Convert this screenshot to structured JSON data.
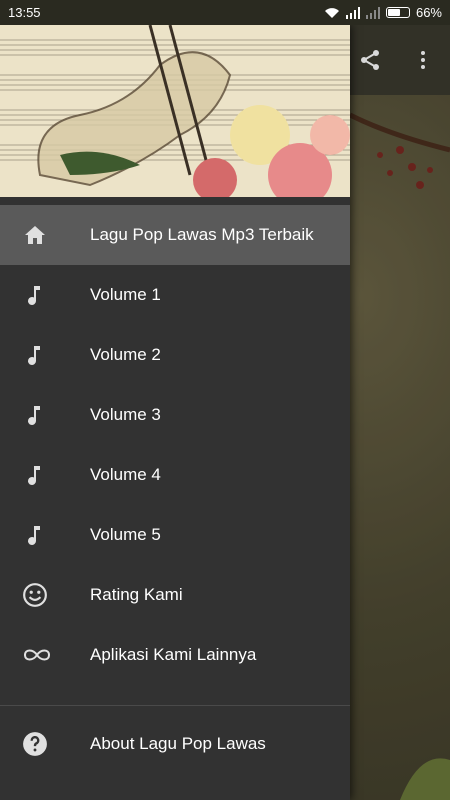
{
  "status_bar": {
    "time": "13:55",
    "battery_percent": "66%",
    "battery_level": 0.66
  },
  "drawer": {
    "items": [
      {
        "label": "Lagu Pop Lawas Mp3 Terbaik",
        "icon": "home-icon",
        "active": true
      },
      {
        "label": "Volume 1",
        "icon": "music-note-icon"
      },
      {
        "label": "Volume 2",
        "icon": "music-note-icon"
      },
      {
        "label": "Volume 3",
        "icon": "music-note-icon"
      },
      {
        "label": "Volume 4",
        "icon": "music-note-icon"
      },
      {
        "label": "Volume 5",
        "icon": "music-note-icon"
      },
      {
        "label": "Rating Kami",
        "icon": "smiley-icon"
      },
      {
        "label": "Aplikasi Kami Lainnya",
        "icon": "infinity-icon"
      }
    ],
    "footer_item": {
      "label": "About Lagu Pop Lawas",
      "icon": "help-icon"
    }
  },
  "app_bar": {
    "actions": [
      "share-icon",
      "more-vert-icon"
    ]
  },
  "colors": {
    "drawer_bg": "#323232",
    "active_item_bg": "#5a5a5a",
    "icon_color": "#e0e0e0"
  }
}
